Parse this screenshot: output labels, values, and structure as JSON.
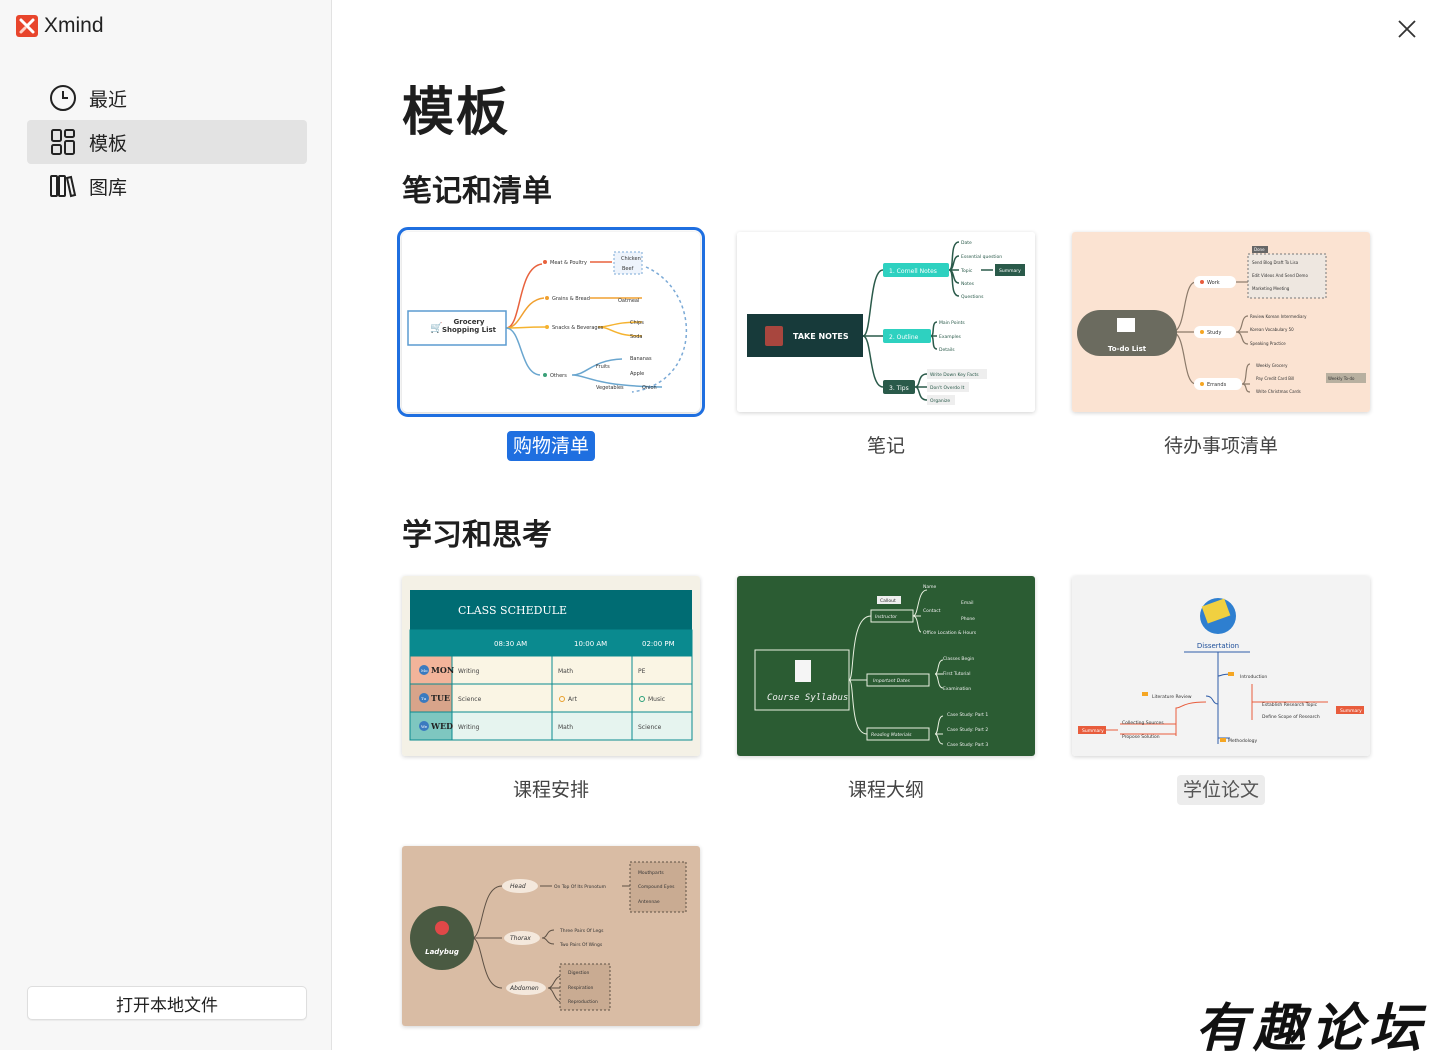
{
  "app": {
    "name": "Xmind"
  },
  "sidebar": {
    "items": [
      {
        "label": "最近",
        "icon": "clock-icon",
        "active": false
      },
      {
        "label": "模板",
        "icon": "grid-icon",
        "active": true
      },
      {
        "label": "图库",
        "icon": "library-icon",
        "active": false
      }
    ],
    "open_local_label": "打开本地文件"
  },
  "main": {
    "title": "模板",
    "sections": [
      {
        "title": "笔记和清单",
        "cards": [
          {
            "label": "购物清单",
            "selected": true,
            "preview": {
              "central": "Grocery\nShopping List",
              "branches": [
                "Meat & Poultry",
                "Grains & Bread",
                "Snacks & Beverages",
                "Others"
              ],
              "leaves": [
                "Chicken",
                "Beef",
                "Oatmeal",
                "Chips",
                "Soda",
                "Bananas",
                "Apple",
                "Fruits",
                "Vegetables",
                "Onion"
              ]
            }
          },
          {
            "label": "笔记",
            "selected": false,
            "preview": {
              "central": "TAKE NOTES",
              "branches": [
                "1. Cornell Notes",
                "2. Outline",
                "3. Tips"
              ],
              "leaves": [
                "Date",
                "Essential question",
                "Topic",
                "Notes",
                "Questions",
                "Summary",
                "Main Points",
                "Examples",
                "Details",
                "Write Down Key Facts",
                "Don't Overdo It",
                "Organize"
              ]
            }
          },
          {
            "label": "待办事项清单",
            "selected": false,
            "preview": {
              "central": "To-do List",
              "branches": [
                "Work",
                "Study",
                "Errands"
              ],
              "leaves": [
                "Done",
                "Send Blog Draft To Lisa",
                "Edit Videos And Send Demo",
                "Marketing Meeting",
                "Review Korean Intermediary",
                "Korean Vocabulary 50",
                "Speaking Practice",
                "Weekly Grocery",
                "Pay Credit Card Bill",
                "Write Christmas Cards",
                "Weekly To-do"
              ]
            }
          }
        ]
      },
      {
        "title": "学习和思考",
        "cards": [
          {
            "label": "课程安排",
            "selected": false,
            "preview": {
              "title": "CLASS SCHEDULE",
              "times": [
                "08:30 AM",
                "10:00 AM",
                "02:00 PM"
              ],
              "rows": [
                {
                  "abbr": "Mo",
                  "day": "MON",
                  "cells": [
                    "Writing",
                    "Math",
                    "PE"
                  ]
                },
                {
                  "abbr": "Tu",
                  "day": "TUE",
                  "cells": [
                    "Science",
                    "Art",
                    "Music"
                  ]
                },
                {
                  "abbr": "We",
                  "day": "WED",
                  "cells": [
                    "Writing",
                    "Math",
                    "Science"
                  ]
                }
              ]
            }
          },
          {
            "label": "课程大纲",
            "selected": false,
            "preview": {
              "central": "Course Syllabus",
              "branches": [
                "Instructor",
                "Important Dates",
                "Reading Materials"
              ],
              "leaves": [
                "Callout",
                "Name",
                "Contact",
                "Email",
                "Phone",
                "Office Location & Hours",
                "Classes Begin",
                "First Tutorial",
                "Examination",
                "Case Study: Part 1",
                "Case Study: Part 2",
                "Case Study: Part 3"
              ]
            }
          },
          {
            "label": "学位论文",
            "selected": false,
            "hover": true,
            "preview": {
              "central": "Dissertation",
              "branches": [
                "Introduction",
                "Literature Review",
                "Methodology"
              ],
              "leaves": [
                "Establish Research Topic",
                "Define Scope of Research",
                "Summary",
                "Collecting Sources",
                "Propose Solution"
              ]
            }
          },
          {
            "label": "",
            "selected": false,
            "preview": {
              "central": "Ladybug",
              "branches": [
                "Head",
                "Thorax",
                "Abdomen"
              ],
              "leaves": [
                "On Top Of Its Pronotum",
                "Mouthparts",
                "Compound Eyes",
                "Antennae",
                "Three Pairs Of Legs",
                "Two Pairs Of Wings",
                "Digestion",
                "Respiration",
                "Reproduction"
              ]
            }
          }
        ]
      }
    ]
  },
  "watermark": "有趣论坛",
  "colors": {
    "accent": "#1f6fe0",
    "sidebar_bg": "#f7f7f7",
    "active_item_bg": "#e3e3e3"
  }
}
